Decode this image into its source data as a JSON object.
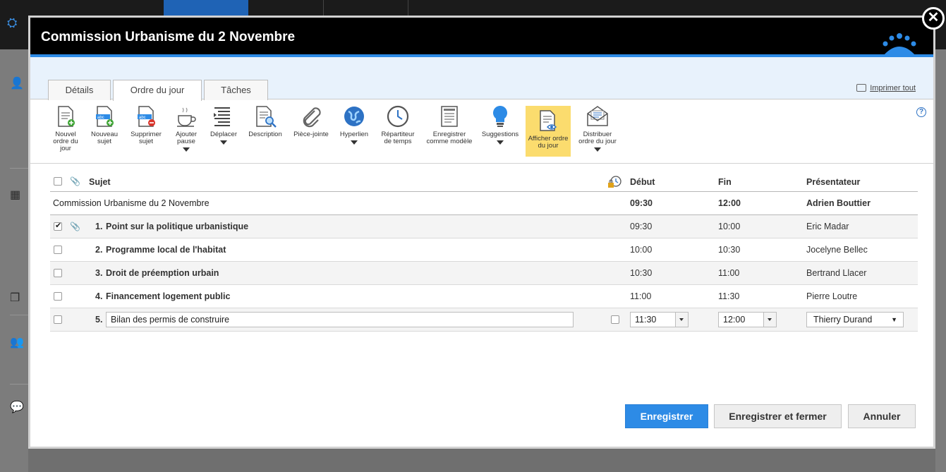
{
  "modal": {
    "title": "Commission Urbanisme du 2 Novembre",
    "close_glyph": "✕"
  },
  "tabs": [
    {
      "label": "Détails",
      "active": false
    },
    {
      "label": "Ordre du jour",
      "active": true
    },
    {
      "label": "Tâches",
      "active": false
    }
  ],
  "print_all": "Imprimer tout",
  "help_glyph": "?",
  "toolbar": [
    {
      "label": "Nouvel ordre du jour",
      "icon": "new-agenda-icon"
    },
    {
      "label": "Nouveau sujet",
      "icon": "new-topic-icon"
    },
    {
      "label": "Supprimer sujet",
      "icon": "delete-topic-icon"
    },
    {
      "label": "Ajouter pause",
      "icon": "coffee-cup-icon",
      "dropdown": true
    },
    {
      "label": "Déplacer",
      "icon": "move-lines-icon",
      "dropdown": true
    },
    {
      "label": "Description",
      "icon": "description-icon"
    },
    {
      "label": "Pièce-jointe",
      "icon": "paperclip-icon"
    },
    {
      "label": "Hyperlien",
      "icon": "globe-icon",
      "dropdown": true
    },
    {
      "label": "Répartiteur de temps",
      "icon": "clock-icon"
    },
    {
      "label": "Enregistrer comme modèle",
      "icon": "template-icon"
    },
    {
      "label": "Suggestions",
      "icon": "lightbulb-icon",
      "dropdown": true
    },
    {
      "label": "Afficher ordre du jour",
      "icon": "view-agenda-icon",
      "highlighted": true
    },
    {
      "label": "Distribuer ordre du jour",
      "icon": "envelope-icon",
      "dropdown": true
    }
  ],
  "columns": {
    "subject": "Sujet",
    "start": "Début",
    "end": "Fin",
    "presenter": "Présentateur"
  },
  "meeting": {
    "title": "Commission Urbanisme du 2 Novembre",
    "start": "09:30",
    "end": "12:00",
    "presenter": "Adrien Bouttier"
  },
  "items": [
    {
      "num": "1.",
      "title": "Point sur la politique urbanistique",
      "start": "09:30",
      "end": "10:00",
      "presenter": "Eric Madar",
      "checked": true,
      "attachment": true
    },
    {
      "num": "2.",
      "title": "Programme local de l'habitat",
      "start": "10:00",
      "end": "10:30",
      "presenter": "Jocelyne Bellec",
      "checked": false
    },
    {
      "num": "3.",
      "title": "Droit de préemption urbain",
      "start": "10:30",
      "end": "11:00",
      "presenter": "Bertrand Llacer",
      "checked": false
    },
    {
      "num": "4.",
      "title": "Financement logement public",
      "start": "11:00",
      "end": "11:30",
      "presenter": "Pierre Loutre",
      "checked": false
    }
  ],
  "edit_row": {
    "num": "5.",
    "title_value": "Bilan des permis de construire",
    "start_value": "11:30",
    "end_value": "12:00",
    "presenter_value": "Thierry Durand"
  },
  "buttons": {
    "save": "Enregistrer",
    "save_close": "Enregistrer et fermer",
    "cancel": "Annuler"
  },
  "colors": {
    "accent_blue": "#2d8be6",
    "header_black": "#000000",
    "highlight_yellow": "#fbdc6e"
  }
}
